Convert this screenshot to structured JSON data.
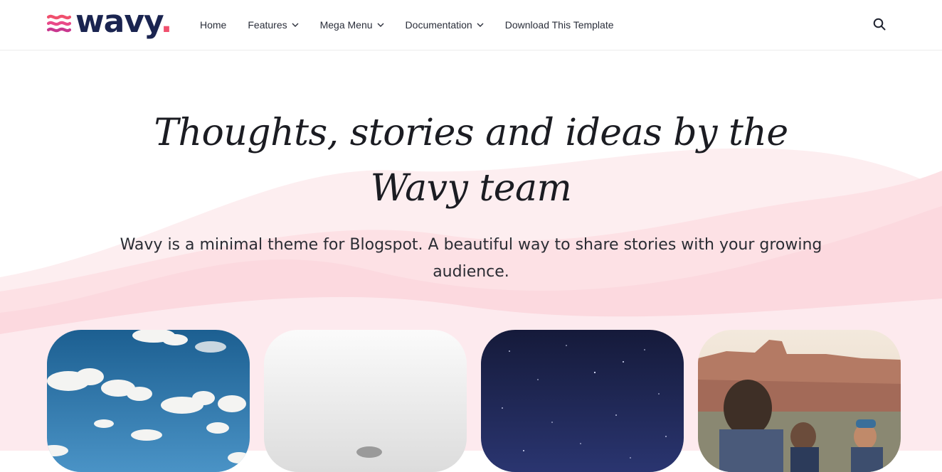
{
  "brand": {
    "name": "wavy",
    "dot": ".",
    "accent_color": "#f0506e",
    "dark_color": "#1a2450"
  },
  "nav": {
    "items": [
      {
        "label": "Home",
        "has_dropdown": false
      },
      {
        "label": "Features",
        "has_dropdown": true
      },
      {
        "label": "Mega Menu",
        "has_dropdown": true
      },
      {
        "label": "Documentation",
        "has_dropdown": true
      },
      {
        "label": "Download This Template",
        "has_dropdown": false
      }
    ],
    "search_icon": "search-icon"
  },
  "hero": {
    "title": "Thoughts, stories and ideas by the Wavy team",
    "subtitle": "Wavy is a minimal theme for Blogspot. A beautiful way to share stories with your growing audience."
  },
  "cards": [
    {
      "image": "sky-clouds"
    },
    {
      "image": "foggy-white"
    },
    {
      "image": "night-sky-stars"
    },
    {
      "image": "men-desert-canyon"
    }
  ]
}
